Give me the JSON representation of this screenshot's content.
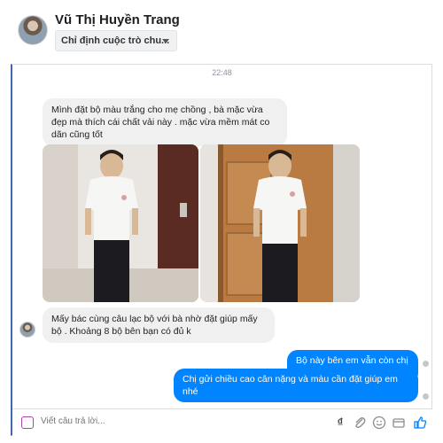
{
  "header": {
    "contact_name": "Vũ Thị Huyền Trang",
    "assign_label": "Chỉ định cuộc trò chu..."
  },
  "thread": {
    "timestamp": "22:48",
    "messages": [
      {
        "from": "contact",
        "text": "Mình đặt bộ màu trắng cho mẹ chồng , bà mặc vừa đẹp mà thích cái chất vải này . mặc vừa mềm mát co dãn cũng tốt"
      },
      {
        "from": "contact",
        "text": "Mấy bác cùng câu lạc bộ với bà nhờ đặt giúp mấy bộ . Khoảng 8 bộ bên bạn có đủ k"
      },
      {
        "from": "me",
        "text": "Bộ này bên em vẫn còn chị ạ"
      },
      {
        "from": "me",
        "text": "Chị gửi chiều cao cân nặng và màu cần đặt giúp em nhé"
      }
    ]
  },
  "composer": {
    "placeholder": "Viết câu trả lời...",
    "tools": [
      "currency-dong-icon",
      "attachment-icon",
      "emoji-icon",
      "payment-icon",
      "like-icon"
    ],
    "currency_glyph": "₫"
  },
  "colors": {
    "accent": "#0084ff",
    "incoming_bubble": "#f1f0f0",
    "panel_border": "#4267b2"
  }
}
